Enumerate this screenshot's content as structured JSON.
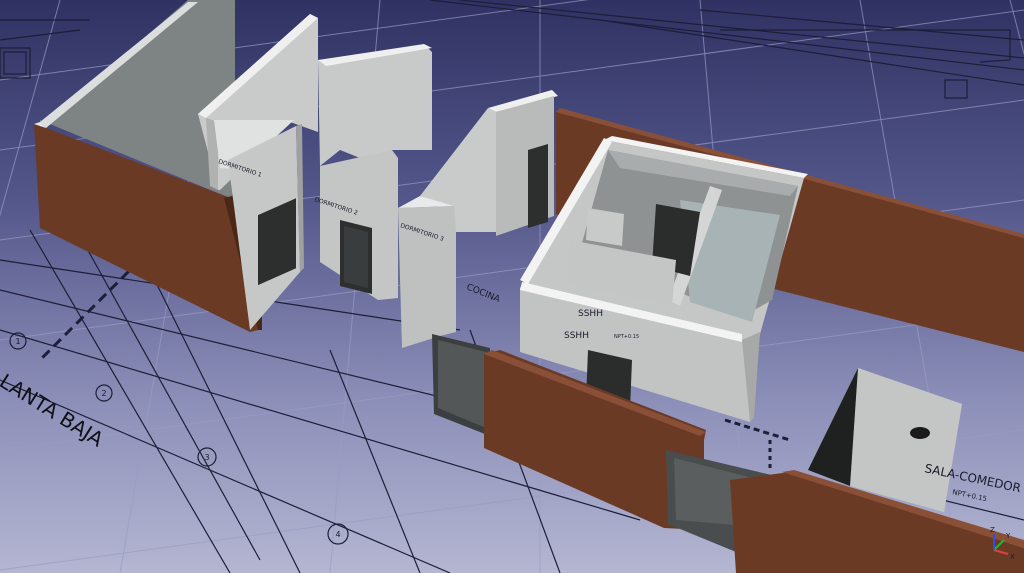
{
  "viewport": {
    "background_top": "#2f3262",
    "background_bottom": "#b4b6d2",
    "wall_brown": "#6b3a25",
    "wall_gray": "#c9cbcb"
  },
  "labels": {
    "planta": "LANTA BAJA",
    "cocina": "COCINA",
    "sshh_1": "SSHH",
    "sshh_2": "SSHH",
    "sala": "SALA-COMEDOR",
    "npt": "NPT+0.15",
    "dorm_1": "DORMITORIO 1",
    "dorm_2": "DORMITORIO 2",
    "dorm_3": "DORMITORIO 3",
    "axis_1": "1",
    "axis_2": "2",
    "axis_3": "3",
    "axis_4": "4"
  },
  "nav_axes": {
    "x": "X",
    "y": "Y",
    "z": "Z",
    "x_color": "#e04040",
    "y_color": "#30b030",
    "z_color": "#3050e0"
  }
}
